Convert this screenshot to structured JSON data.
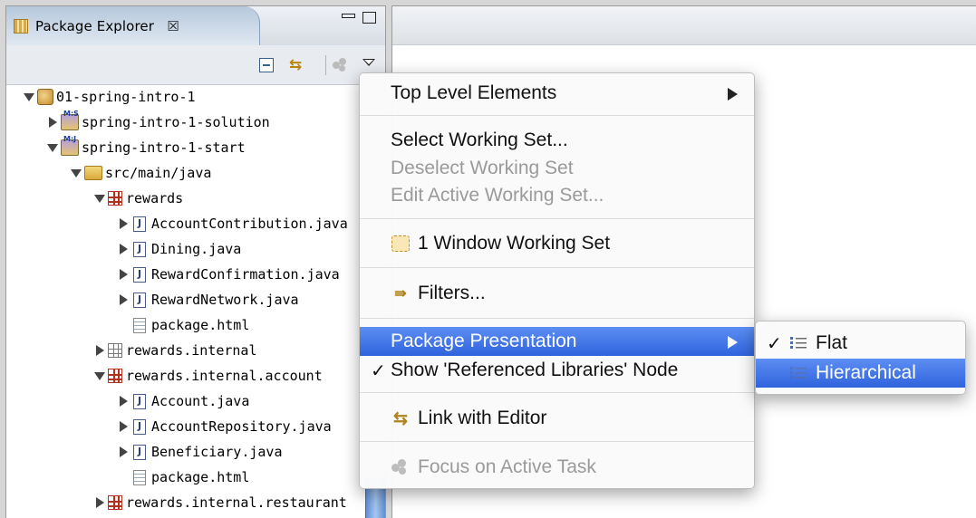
{
  "view": {
    "title": "Package Explorer",
    "close_glyph": "☒"
  },
  "tree": [
    {
      "label": "01-spring-intro-1",
      "icon": "working-set-icon",
      "expander": "open",
      "depth": 0
    },
    {
      "label": "spring-intro-1-solution",
      "icon": "project-icon",
      "expander": "closed",
      "depth": 1
    },
    {
      "label": "spring-intro-1-start",
      "icon": "project-icon",
      "expander": "open",
      "depth": 1
    },
    {
      "label": "src/main/java",
      "icon": "source-folder-icon",
      "expander": "open",
      "depth": 2
    },
    {
      "label": "rewards",
      "icon": "package-icon",
      "expander": "open",
      "depth": 3
    },
    {
      "label": "AccountContribution.java",
      "icon": "java-file-icon",
      "expander": "closed",
      "depth": 4
    },
    {
      "label": "Dining.java",
      "icon": "java-file-icon",
      "expander": "closed",
      "depth": 4
    },
    {
      "label": "RewardConfirmation.java",
      "icon": "java-file-icon",
      "expander": "closed",
      "depth": 4
    },
    {
      "label": "RewardNetwork.java",
      "icon": "java-file-icon",
      "expander": "closed",
      "depth": 4
    },
    {
      "label": "package.html",
      "icon": "html-file-icon",
      "expander": "none",
      "depth": 4
    },
    {
      "label": "rewards.internal",
      "icon": "empty-package-icon",
      "expander": "closed",
      "depth": 3
    },
    {
      "label": "rewards.internal.account",
      "icon": "package-icon",
      "expander": "open",
      "depth": 3
    },
    {
      "label": "Account.java",
      "icon": "java-file-icon",
      "expander": "closed",
      "depth": 4
    },
    {
      "label": "AccountRepository.java",
      "icon": "java-file-icon",
      "expander": "closed",
      "depth": 4
    },
    {
      "label": "Beneficiary.java",
      "icon": "java-file-icon",
      "expander": "closed",
      "depth": 4
    },
    {
      "label": "package.html",
      "icon": "html-file-icon",
      "expander": "none",
      "depth": 4
    },
    {
      "label": "rewards.internal.restaurant",
      "icon": "package-icon",
      "expander": "closed",
      "depth": 3
    }
  ],
  "menu": {
    "top_level": "Top Level Elements",
    "select_ws": "Select Working Set...",
    "deselect_ws": "Deselect Working Set",
    "edit_ws": "Edit Active Working Set...",
    "window_ws": "1 Window Working Set",
    "filters": "Filters...",
    "package_presentation": "Package Presentation",
    "show_ref_libs": "Show 'Referenced Libraries' Node",
    "link_editor": "Link with Editor",
    "focus_task": "Focus on Active Task",
    "check": "✓"
  },
  "submenu": {
    "flat": "Flat",
    "hierarchical": "Hierarchical",
    "check": "✓"
  },
  "colors": {
    "selection": "#2f63dd",
    "package_red": "#b5301c"
  }
}
